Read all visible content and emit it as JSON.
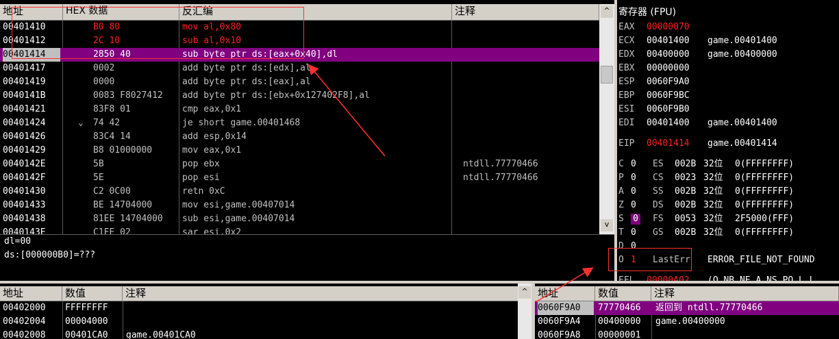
{
  "disasm": {
    "headers": {
      "addr": "地址",
      "hex": "HEX 数据",
      "asm": "反汇编",
      "comment": "注释"
    },
    "rows": [
      {
        "addr": "00401410",
        "hex": "B0 80",
        "asm": "mov al,0x80",
        "comment": "",
        "state": "changed"
      },
      {
        "addr": "00401412",
        "hex": "2C 10",
        "asm": "sub al,0x10",
        "comment": "",
        "state": "changed"
      },
      {
        "addr": "00401414",
        "hex": "2850 40",
        "asm": "sub byte ptr ds:[eax+0x40],dl",
        "comment": "",
        "state": "selected"
      },
      {
        "addr": "00401417",
        "hex": "0002",
        "asm": "add byte ptr ds:[edx],al",
        "comment": "",
        "state": ""
      },
      {
        "addr": "00401419",
        "hex": "0000",
        "asm": "add byte ptr ds:[eax],al",
        "comment": "",
        "state": ""
      },
      {
        "addr": "0040141B",
        "hex": "0083 F8027412",
        "asm": "add byte ptr ds:[ebx+0x127402F8],al",
        "comment": "",
        "state": ""
      },
      {
        "addr": "00401421",
        "hex": "83F8 01",
        "asm": "cmp eax,0x1",
        "comment": "",
        "state": ""
      },
      {
        "addr": "00401424",
        "hex": "74 42",
        "asm": "je short game.00401468",
        "comment": "",
        "state": "jump"
      },
      {
        "addr": "00401426",
        "hex": "83C4 14",
        "asm": "add esp,0x14",
        "comment": "",
        "state": ""
      },
      {
        "addr": "00401429",
        "hex": "B8 01000000",
        "asm": "mov eax,0x1",
        "comment": "",
        "state": ""
      },
      {
        "addr": "0040142E",
        "hex": "5B",
        "asm": "pop ebx",
        "comment": "ntdll.77770466",
        "state": ""
      },
      {
        "addr": "0040142F",
        "hex": "5E",
        "asm": "pop esi",
        "comment": "ntdll.77770466",
        "state": ""
      },
      {
        "addr": "00401430",
        "hex": "C2 0C00",
        "asm": "retn 0xC",
        "comment": "",
        "state": ""
      },
      {
        "addr": "00401433",
        "hex": "BE 14704000",
        "asm": "mov esi,game.00407014",
        "comment": "",
        "state": ""
      },
      {
        "addr": "00401438",
        "hex": "81EE 14704000",
        "asm": "sub esi,game.00407014",
        "comment": "",
        "state": ""
      },
      {
        "addr": "0040143E",
        "hex": "C1FE 02",
        "asm": "sar esi,0x2",
        "comment": "",
        "state": ""
      }
    ],
    "jump_glyph": "⌄",
    "scroll_up": "^",
    "scroll_down": "v"
  },
  "info": {
    "line1": "dl=00",
    "line2": "ds:[000000B0]=???"
  },
  "registers": {
    "title": "寄存器 (FPU)",
    "gp": [
      {
        "name": "EAX",
        "value": "00000070",
        "changed": true,
        "extra": ""
      },
      {
        "name": "ECX",
        "value": "00401400",
        "changed": false,
        "extra": "game.00401400"
      },
      {
        "name": "EDX",
        "value": "00400000",
        "changed": false,
        "extra": "game.00400000"
      },
      {
        "name": "EBX",
        "value": "00000000",
        "changed": false,
        "extra": ""
      },
      {
        "name": "ESP",
        "value": "0060F9A0",
        "changed": false,
        "extra": ""
      },
      {
        "name": "EBP",
        "value": "0060F9BC",
        "changed": false,
        "extra": ""
      },
      {
        "name": "ESI",
        "value": "0060F9B0",
        "changed": false,
        "extra": ""
      },
      {
        "name": "EDI",
        "value": "00401400",
        "changed": false,
        "extra": "game.00401400"
      }
    ],
    "eip": {
      "name": "EIP",
      "value": "00401414",
      "extra": "game.00401414"
    },
    "flags": [
      {
        "flag": "C",
        "val": "0",
        "seg": "ES",
        "sel": "002B",
        "bits": "32位",
        "base": "0(FFFFFFFF)",
        "highlight": false
      },
      {
        "flag": "P",
        "val": "0",
        "seg": "CS",
        "sel": "0023",
        "bits": "32位",
        "base": "0(FFFFFFFF)",
        "highlight": false
      },
      {
        "flag": "A",
        "val": "0",
        "seg": "SS",
        "sel": "002B",
        "bits": "32位",
        "base": "0(FFFFFFFF)",
        "highlight": false
      },
      {
        "flag": "Z",
        "val": "0",
        "seg": "DS",
        "sel": "002B",
        "bits": "32位",
        "base": "0(FFFFFFFF)",
        "highlight": false
      },
      {
        "flag": "S",
        "val": "0",
        "seg": "FS",
        "sel": "0053",
        "bits": "32位",
        "base": "2F5000(FFF)",
        "highlight": true
      },
      {
        "flag": "T",
        "val": "0",
        "seg": "GS",
        "sel": "002B",
        "bits": "32位",
        "base": "0(FFFFFFFF)",
        "highlight": false
      },
      {
        "flag": "D",
        "val": "0",
        "seg": "",
        "sel": "",
        "bits": "",
        "base": "",
        "highlight": false
      }
    ],
    "o_flag": {
      "flag": "O",
      "val": "1",
      "label": "LastErr",
      "text": "ERROR_FILE_NOT_FOUND"
    },
    "efl": {
      "name": "EFL",
      "value": "00000A02",
      "text": "(O,NB,NE,A,NS,PO,L,L"
    }
  },
  "dump": {
    "headers": {
      "addr": "地址",
      "value": "数值",
      "comment": "注释"
    },
    "rows": [
      {
        "addr": "00402000",
        "value": "FFFFFFFF",
        "comment": ""
      },
      {
        "addr": "00402004",
        "value": "00004000",
        "comment": ""
      },
      {
        "addr": "00402008",
        "value": "00401CA0",
        "comment": "game.00401CA0"
      }
    ]
  },
  "stack": {
    "headers": {
      "addr": "地址",
      "value": "数值",
      "comment": "注释"
    },
    "rows": [
      {
        "addr": "0060F9A0",
        "value": "77770466",
        "comment": "返回到 ntdll.77770466",
        "selected": true
      },
      {
        "addr": "0060F9A4",
        "value": "00400000",
        "comment": "game.00400000",
        "selected": false
      },
      {
        "addr": "0060F9A8",
        "value": "00000001",
        "comment": "",
        "selected": false
      }
    ]
  },
  "colors": {
    "selection": "#800080",
    "changed": "#ff2020",
    "annotation": "#ff3030"
  }
}
